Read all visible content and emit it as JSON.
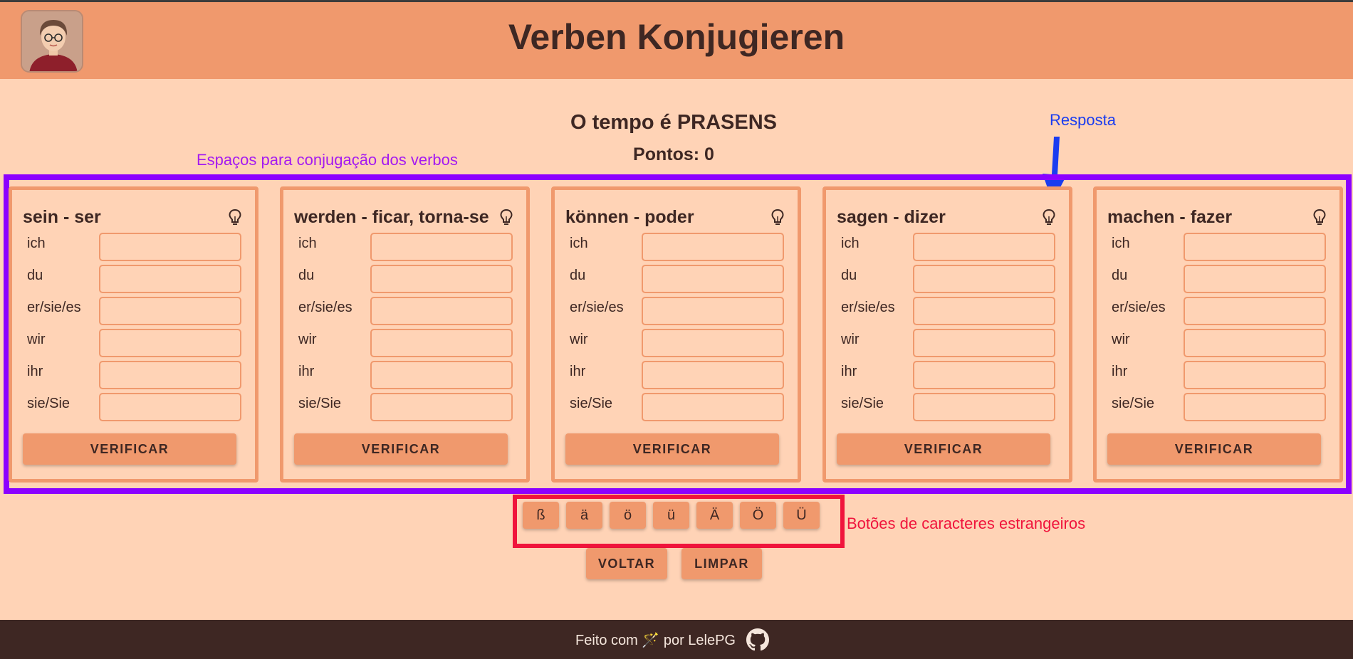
{
  "header": {
    "title": "Verben Konjugieren",
    "avatar_icon": "avatar-icon"
  },
  "status": {
    "tense_text": "O tempo é PRASENS",
    "points_text": "Pontos: 0"
  },
  "annotations": {
    "verbs": "Espaços para conjugação dos verbos",
    "answer": "Resposta",
    "chars": "Botões de caracteres estrangeiros"
  },
  "pronouns": [
    "ich",
    "du",
    "er/sie/es",
    "wir",
    "ihr",
    "sie/Sie"
  ],
  "cards": [
    {
      "title": "sein - ser",
      "verify_label": "VERIFICAR"
    },
    {
      "title": "werden - ficar, torna-se",
      "verify_label": "VERIFICAR"
    },
    {
      "title": "können - poder",
      "verify_label": "VERIFICAR"
    },
    {
      "title": "sagen - dizer",
      "verify_label": "VERIFICAR"
    },
    {
      "title": "machen - fazer",
      "verify_label": "VERIFICAR"
    }
  ],
  "special_chars": [
    "ß",
    "ä",
    "ö",
    "ü",
    "Ä",
    "Ö",
    "Ü"
  ],
  "nav": {
    "back_label": "VOLTAR",
    "clear_label": "LIMPAR"
  },
  "footer": {
    "text": "Feito com 🪄 por LelePG",
    "github_icon": "github-icon"
  },
  "colors": {
    "header": "#f0996d",
    "background": "#ffd3b6",
    "footer": "#3e2723",
    "text": "#3e2723",
    "frame_verbs": "#8c00ff",
    "frame_chars": "#f0143c",
    "arrow": "#1a3cf0"
  }
}
